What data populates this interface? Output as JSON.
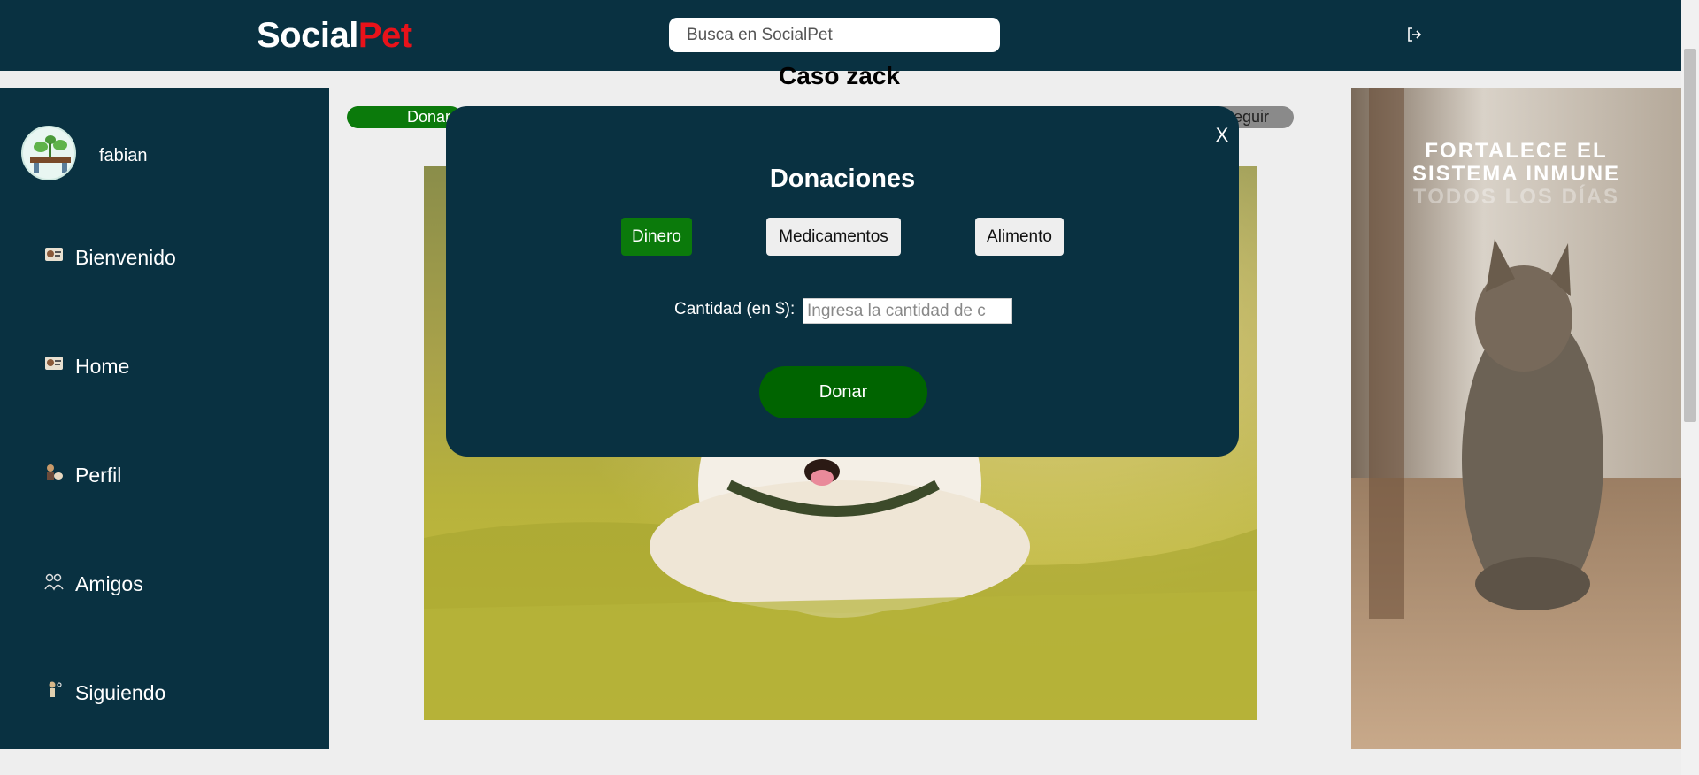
{
  "header": {
    "logo_part1": "Social",
    "logo_part2": "Pet",
    "search_placeholder": "Busca en SocialPet",
    "logout_icon": "logout-icon"
  },
  "sidebar": {
    "username": "fabian",
    "items": [
      {
        "label": "Bienvenido",
        "icon": "dog-card-icon"
      },
      {
        "label": "Home",
        "icon": "dog-card-icon"
      },
      {
        "label": "Perfil",
        "icon": "dog-person-icon"
      },
      {
        "label": "Amigos",
        "icon": "friends-icon"
      },
      {
        "label": "Siguiendo",
        "icon": "follow-icon"
      }
    ]
  },
  "post": {
    "title": "Caso zack",
    "donar_pill": "Donar",
    "seguir_pill": "Seguir"
  },
  "ad": {
    "line1": "FORTALECE EL",
    "line2": "SISTEMA INMUNE",
    "line3": "TODOS LOS DÍAS"
  },
  "modal": {
    "close": "X",
    "title": "Donaciones",
    "tabs": [
      {
        "label": "Dinero",
        "active": true
      },
      {
        "label": "Medicamentos",
        "active": false
      },
      {
        "label": "Alimento",
        "active": false
      }
    ],
    "quantity_label": "Cantidad (en $):",
    "quantity_placeholder": "Ingresa la cantidad de c",
    "submit": "Donar"
  },
  "colors": {
    "primary": "#093141",
    "accent_green": "#0b7a0b",
    "logo_red": "#e8121a"
  }
}
